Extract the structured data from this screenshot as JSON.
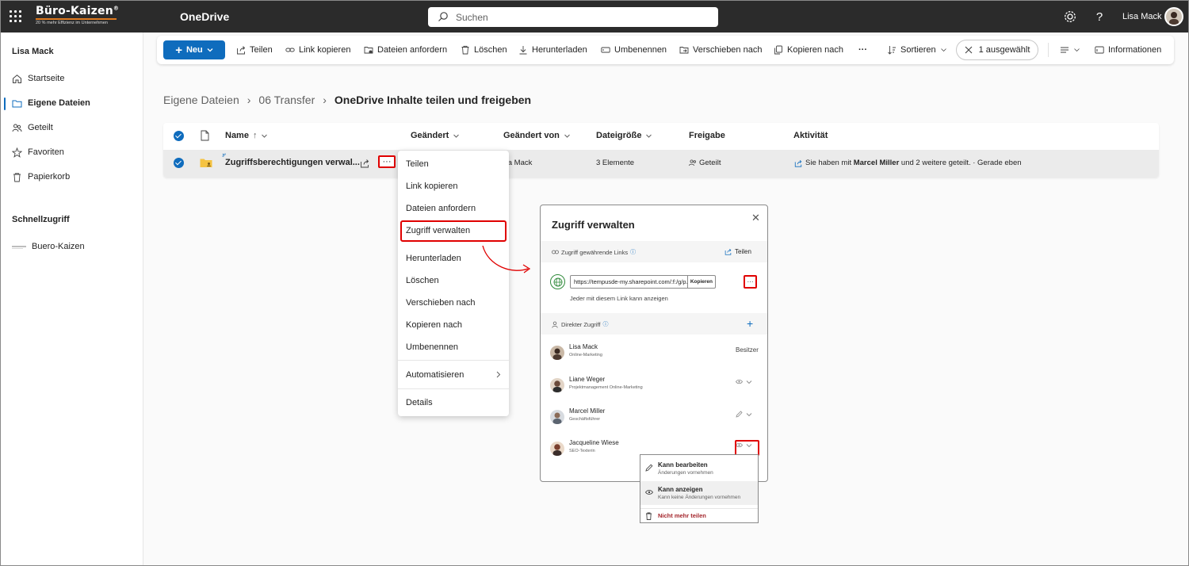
{
  "topbar": {
    "brand_name": "Büro-Kaizen",
    "brand_mark": "®",
    "brand_tagline": "20 % mehr Effizienz im Unternehmen",
    "app_name": "OneDrive",
    "search_placeholder": "Suchen",
    "user_name": "Lisa Mack",
    "icons": [
      "waffle-icon",
      "search-icon",
      "gear-icon",
      "help-icon"
    ]
  },
  "sidebar": {
    "user": "Lisa Mack",
    "items": [
      {
        "label": "Startseite",
        "icon": "home-icon"
      },
      {
        "label": "Eigene Dateien",
        "icon": "folder-icon",
        "active": true
      },
      {
        "label": "Geteilt",
        "icon": "people-icon"
      },
      {
        "label": "Favoriten",
        "icon": "star-icon"
      },
      {
        "label": "Papierkorb",
        "icon": "trash-icon"
      }
    ],
    "quick_access_title": "Schnellzugriff",
    "quick_access_items": [
      {
        "label": "Buero-Kaizen"
      }
    ]
  },
  "commandbar": {
    "new": "Neu",
    "share": "Teilen",
    "copy_link": "Link kopieren",
    "request_files": "Dateien anfordern",
    "delete": "Löschen",
    "download": "Herunterladen",
    "rename": "Umbenennen",
    "move_to": "Verschieben nach",
    "copy_to": "Kopieren nach",
    "more": "···",
    "sort": "Sortieren",
    "selected": "1 ausgewählt",
    "info": "Informationen"
  },
  "breadcrumb": {
    "items": [
      "Eigene Dateien",
      "06 Transfer"
    ],
    "current": "OneDrive Inhalte teilen und freigeben",
    "separator": "›"
  },
  "table": {
    "columns": {
      "name": "Name",
      "name_sort": "↑",
      "modified": "Geändert",
      "modified_by": "Geändert von",
      "size": "Dateigröße",
      "sharing": "Freigabe",
      "activity": "Aktivität"
    },
    "row": {
      "name": "Zugriffsberechtigungen verwal...",
      "modified_by": "sa Mack",
      "size": "3 Elemente",
      "sharing": "Geteilt",
      "activity_prefix": "Sie haben mit ",
      "activity_bold": "Marcel Miller",
      "activity_suffix": " und 2 weitere geteilt. · Gerade eben"
    }
  },
  "context_menu": {
    "items": [
      "Teilen",
      "Link kopieren",
      "Dateien anfordern",
      "Zugriff verwalten",
      "Herunterladen",
      "Löschen",
      "Verschieben nach",
      "Kopieren nach",
      "Umbenennen",
      "Automatisieren",
      "Details"
    ],
    "highlighted": "Zugriff verwalten"
  },
  "dialog": {
    "title": "Zugriff verwalten",
    "links_section": "Zugriff gewährende Links",
    "share_action": "Teilen",
    "url": "https://tempusde-my.sharepoint.com/:f:/g/p...",
    "copy": "Kopieren",
    "link_note": "Jeder mit diesem Link kann anzeigen",
    "direct_section": "Direkter Zugriff",
    "people": [
      {
        "name": "Lisa Mack",
        "role": "Online-Marketing",
        "access": "Besitzer",
        "avatar_color": "#c9b8a6"
      },
      {
        "name": "Liane Weger",
        "role": "Projektmanagement Online-Marketing",
        "access": "",
        "avatar_color": "#6b4a3a"
      },
      {
        "name": "Marcel Miller",
        "role": "Geschäftsführer",
        "access": "",
        "avatar_color": "#5b6470"
      },
      {
        "name": "Jacqueline Wiese",
        "role": "SEO-Texterin",
        "access": "",
        "avatar_color": "#7a3f2e"
      }
    ]
  },
  "permission_menu": {
    "edit_title": "Kann bearbeiten",
    "edit_desc": "Änderungen vornehmen",
    "view_title": "Kann anzeigen",
    "view_desc": "Kann keine Änderungen vornehmen",
    "stop": "Nicht mehr teilen"
  },
  "colors": {
    "accent": "#0f6cbd",
    "highlight": "#e00000",
    "danger": "#a4262c",
    "topbar": "#2b2b2b",
    "brand_underline": "#e07a1f"
  }
}
